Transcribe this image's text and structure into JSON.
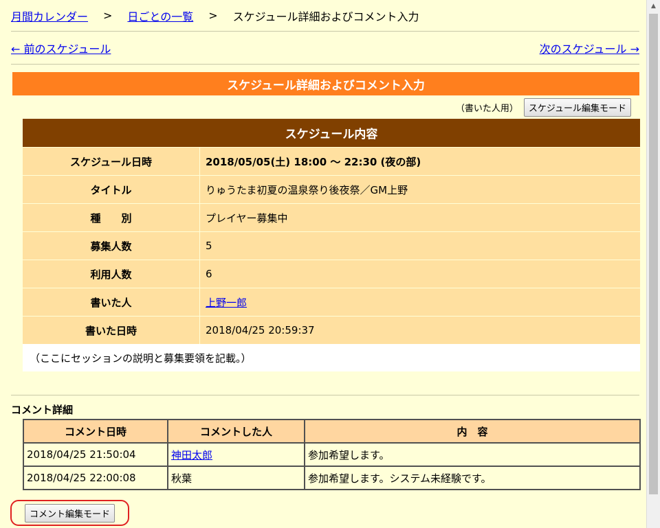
{
  "breadcrumb": {
    "calendar": "月間カレンダー",
    "sep1": ">",
    "daily": "日ごとの一覧",
    "sep2": ">",
    "current": "スケジュール詳細およびコメント入力"
  },
  "nav": {
    "prev": "← 前のスケジュール",
    "next": "次のスケジュール →"
  },
  "section_title": "スケジュール詳細およびコメント入力",
  "edit_note": "（書いた人用）",
  "edit_button": "スケジュール編集モード",
  "schedule": {
    "header": "スケジュール内容",
    "rows": [
      {
        "key": "スケジュール日時",
        "value": "2018/05/05(土) 18:00 ～ 22:30 (夜の部)"
      },
      {
        "key": "タイトル",
        "value": "りゅうたま初夏の温泉祭り後夜祭／GM上野"
      },
      {
        "key": "種　　別",
        "value": "プレイヤー募集中"
      },
      {
        "key": "募集人数",
        "value": "5"
      },
      {
        "key": "利用人数",
        "value": "6"
      },
      {
        "key": "書いた人",
        "value": "上野一郎"
      },
      {
        "key": "書いた日時",
        "value": "2018/04/25 20:59:37"
      }
    ],
    "description": "（ここにセッションの説明と募集要領を記載。）"
  },
  "comments": {
    "title": "コメント詳細",
    "headers": [
      "コメント日時",
      "コメントした人",
      "内　容"
    ],
    "rows": [
      {
        "date": "2018/04/25 21:50:04",
        "person": "神田太郎",
        "content": "参加希望します。"
      },
      {
        "date": "2018/04/25 22:00:08",
        "person": "秋葉",
        "content": "参加希望します。システム未経験です。"
      }
    ]
  },
  "comment_edit_button": "コメント編集モード"
}
